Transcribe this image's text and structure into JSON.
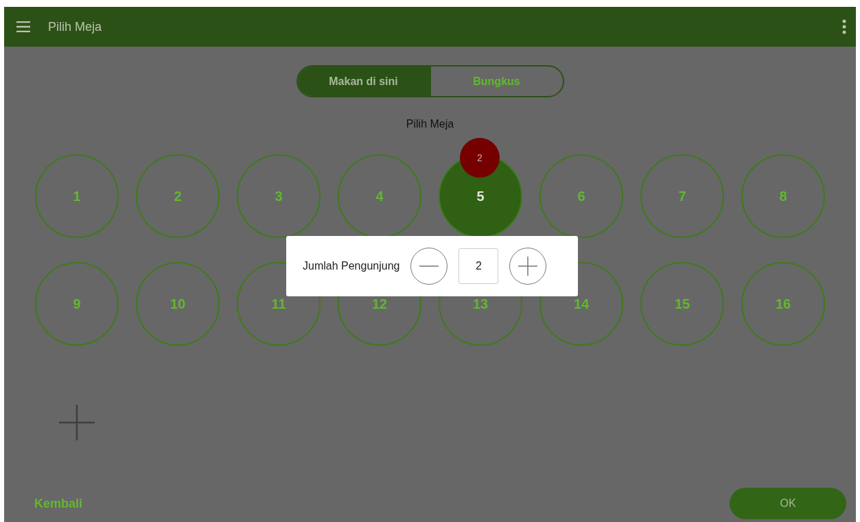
{
  "app_bar": {
    "title": "Pilih Meja"
  },
  "tabs": [
    {
      "label": "Makan di sini",
      "selected": true
    },
    {
      "label": "Bungkus",
      "selected": false
    }
  ],
  "heading": "Pilih Meja",
  "tables": [
    {
      "number": "1",
      "selected": false
    },
    {
      "number": "2",
      "selected": false
    },
    {
      "number": "3",
      "selected": false
    },
    {
      "number": "4",
      "selected": false
    },
    {
      "number": "5",
      "selected": true,
      "badge": "2"
    },
    {
      "number": "6",
      "selected": false
    },
    {
      "number": "7",
      "selected": false
    },
    {
      "number": "8",
      "selected": false
    },
    {
      "number": "9",
      "selected": false
    },
    {
      "number": "10",
      "selected": false
    },
    {
      "number": "11",
      "selected": false
    },
    {
      "number": "12",
      "selected": false
    },
    {
      "number": "13",
      "selected": false
    },
    {
      "number": "14",
      "selected": false
    },
    {
      "number": "15",
      "selected": false
    },
    {
      "number": "16",
      "selected": false
    }
  ],
  "dialog": {
    "label": "Jumlah Pengunjung",
    "value": "2"
  },
  "footer": {
    "back": "Kembali",
    "ok": "OK"
  }
}
